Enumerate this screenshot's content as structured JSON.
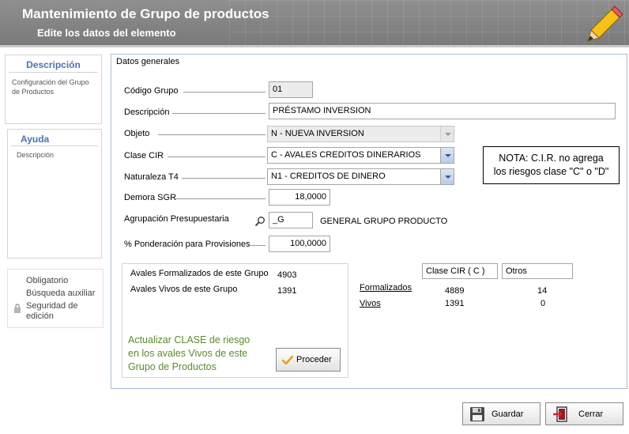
{
  "header": {
    "title": "Mantenimiento de Grupo de productos",
    "subtitle": "Edite los datos del elemento"
  },
  "left": {
    "descripcion_title": "Descripción",
    "descripcion_text": "Configuración del Grupo de Productos",
    "ayuda_title": "Ayuda",
    "ayuda_text": "Descripción",
    "legend": {
      "obligatorio": "Obligatorio",
      "busqueda": "Búsqueda auxiliar",
      "seguridad": "Seguridad de edición"
    }
  },
  "form": {
    "section_title": "Datos generales",
    "codigo": {
      "label": "Código Grupo",
      "value": "01"
    },
    "descripcion": {
      "label": "Descripción",
      "value": "PRÉSTAMO INVERSION"
    },
    "objeto": {
      "label": "Objeto",
      "value": "N - NUEVA INVERSION"
    },
    "clase_cir": {
      "label": "Clase CIR",
      "value": "C - AVALES CREDITOS DINERARIOS"
    },
    "naturaleza": {
      "label": "Naturaleza T4",
      "value": "N1 - CREDITOS DE DINERO"
    },
    "demora": {
      "label": "Demora SGR",
      "value": "18,0000"
    },
    "agrupacion": {
      "label": "Agrupación Presupuestaria",
      "value": "_G",
      "description": "GENERAL GRUPO PRODUCTO"
    },
    "ponderacion": {
      "label": "% Ponderación para Provisiones",
      "value": "100,0000"
    }
  },
  "note": {
    "line1": "NOTA: C.I.R. no agrega",
    "line2": "los riesgos clase \"C\" o \"D\""
  },
  "stats": {
    "formalizados_label": "Avales Formalizados de este Grupo",
    "formalizados_value": "4903",
    "vivos_label": "Avales Vivos de este Grupo",
    "vivos_value": "1391",
    "action_line1": "Actualizar CLASE de riesgo",
    "action_line2": "en los avales Vivos de este",
    "action_line3": "Grupo de Productos",
    "proceder_label": "Proceder"
  },
  "breakdown": {
    "col1_header": "Clase CIR ( C )",
    "col2_header": "Otros",
    "rows": [
      {
        "label": "Formalizados",
        "c": "4889",
        "otros": "14"
      },
      {
        "label": "Vivos",
        "c": "1391",
        "otros": "0"
      }
    ]
  },
  "footer": {
    "guardar_label": "Guardar",
    "cerrar_label": "Cerrar"
  },
  "colors": {
    "header_bg": "#888888",
    "panel_title": "#4a74b1",
    "action_text": "#5c8a2f",
    "frame_border": "#a9bcd3"
  },
  "icons": [
    "pencil-icon",
    "magnifier-icon",
    "lock-icon",
    "check-icon",
    "floppy-icon",
    "exit-icon"
  ]
}
